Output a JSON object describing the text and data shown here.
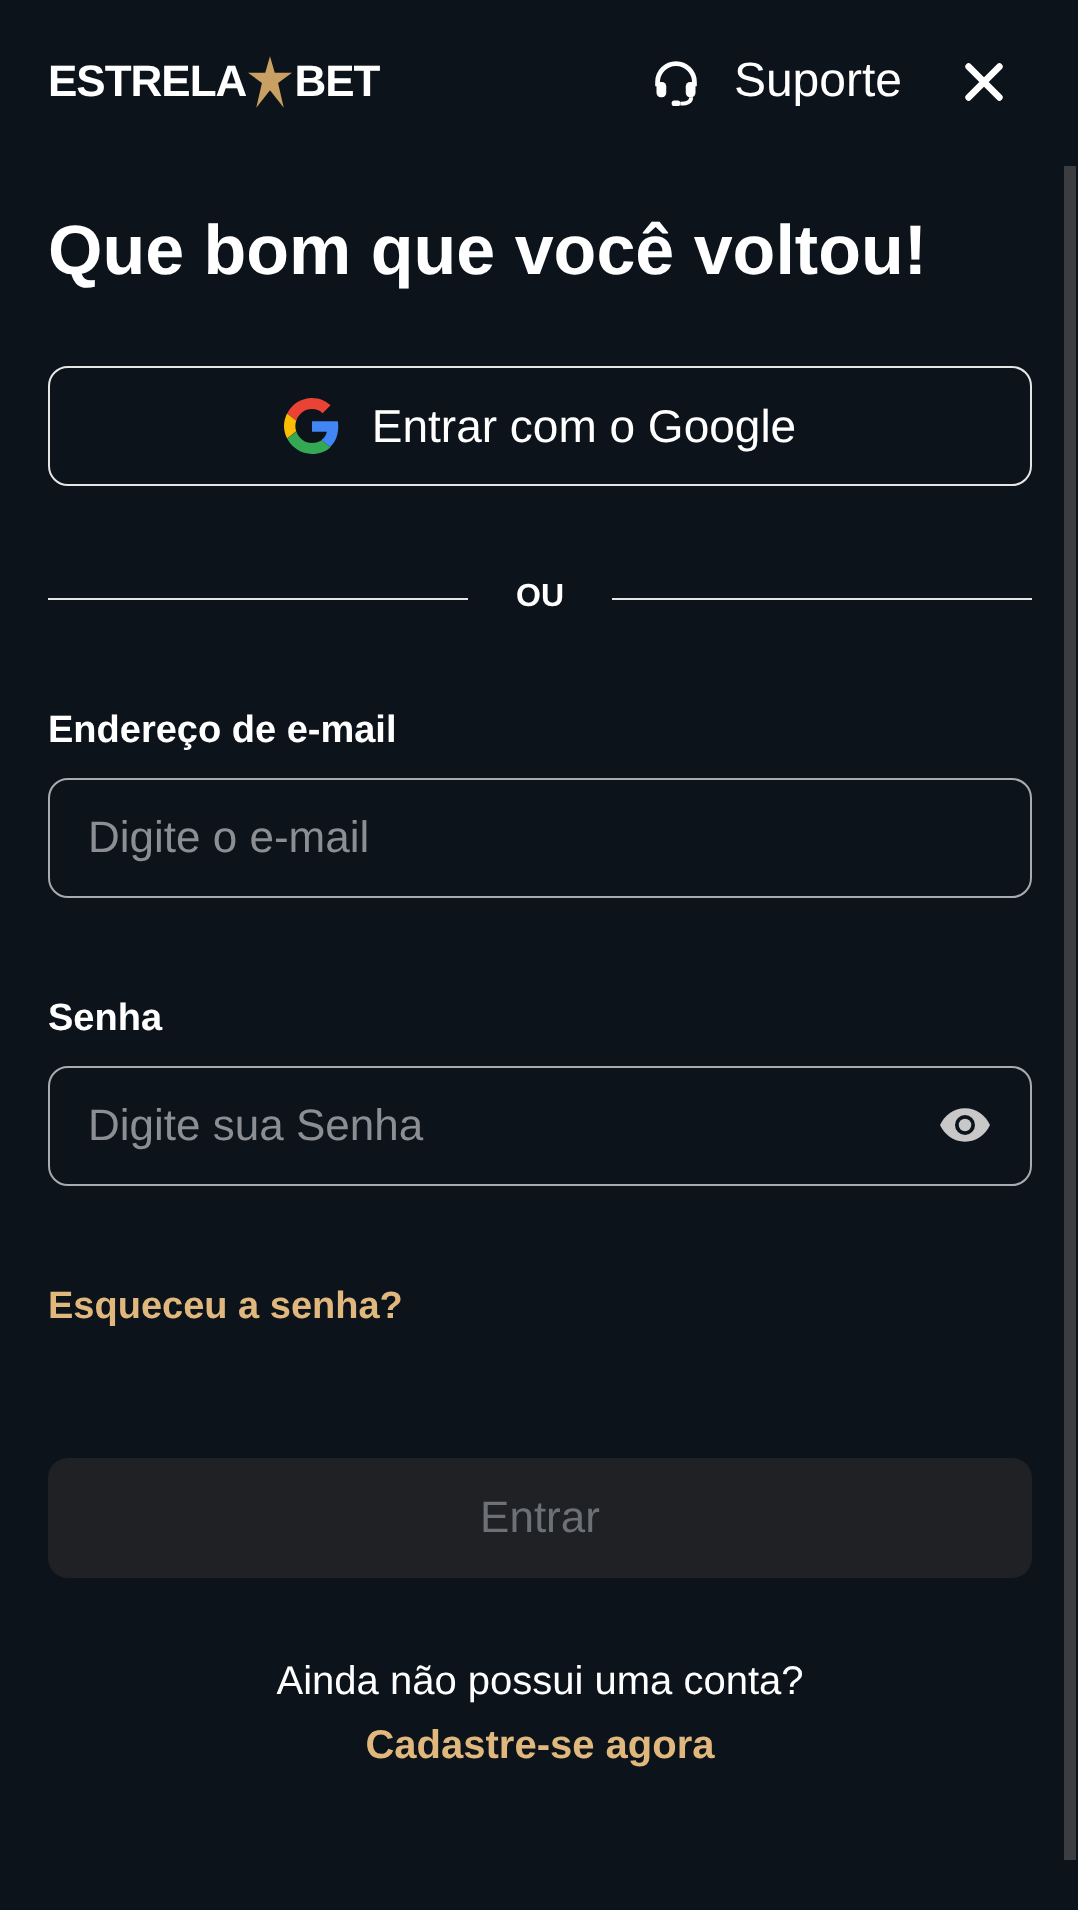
{
  "header": {
    "logo": {
      "left": "ESTRELA",
      "right": "BET"
    },
    "support": "Suporte"
  },
  "title": "Que bom que você voltou!",
  "google_button": {
    "label": "Entrar com o Google"
  },
  "divider": "OU",
  "fields": [
    {
      "label": "Endereço de e-mail",
      "placeholder": "Digite o e-mail",
      "kind": "text"
    },
    {
      "label": "Senha",
      "placeholder": "Digite sua Senha",
      "kind": "password"
    }
  ],
  "forgot_link": "Esqueceu a senha?",
  "submit": {
    "label": "Entrar",
    "disabled": true
  },
  "footer": {
    "prompt": "Ainda não possui uma conta?",
    "link": "Cadastre-se agora"
  }
}
